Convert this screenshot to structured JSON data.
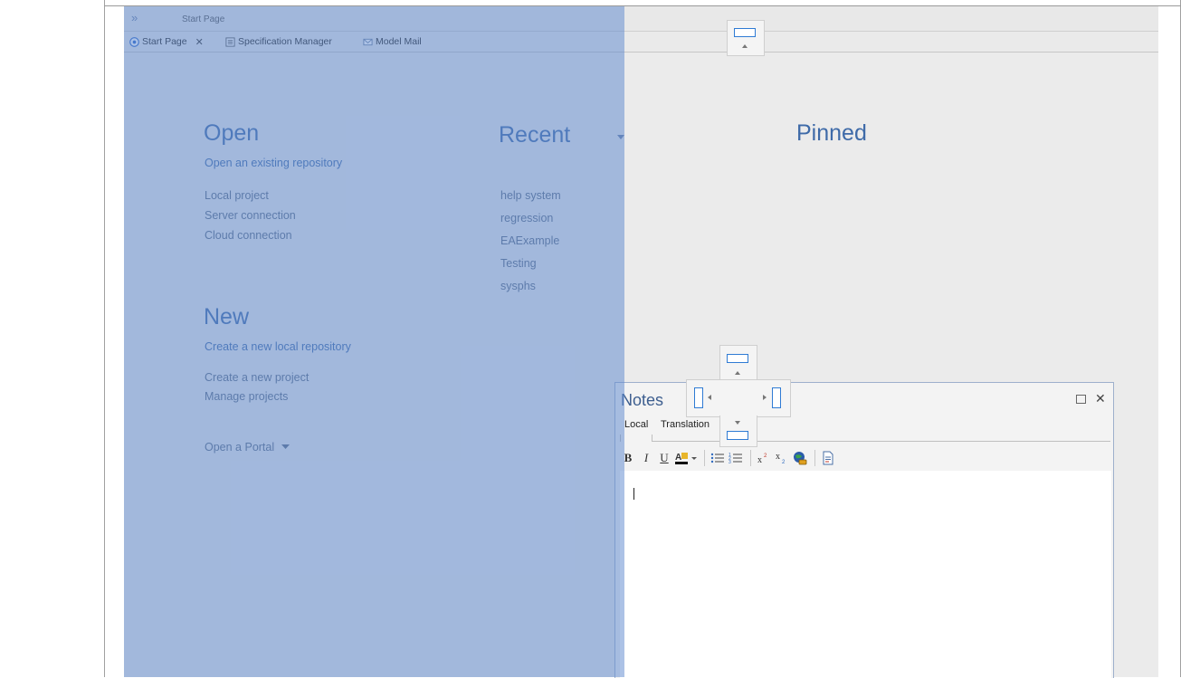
{
  "window": {
    "title": "Start Page"
  },
  "tabs": [
    {
      "label": "Start Page",
      "icon": "start-page-icon",
      "closable": true,
      "active": true
    },
    {
      "label": "Specification Manager",
      "icon": "specification-manager-icon"
    },
    {
      "label": "Model Mail",
      "icon": "mail-icon"
    }
  ],
  "start_page": {
    "open": {
      "heading": "Open",
      "subheading": "Open an existing repository",
      "links": [
        "Local project",
        "Server connection",
        "Cloud connection"
      ]
    },
    "new": {
      "heading": "New",
      "subheading": "Create a new local repository",
      "links": [
        "Create a new project",
        "Manage projects"
      ],
      "portal": "Open a Portal"
    },
    "recent": {
      "heading": "Recent",
      "items": [
        "help system",
        "regression",
        "EAExample",
        "Testing",
        "sysphs"
      ]
    },
    "pinned": {
      "heading": "Pinned"
    }
  },
  "notes": {
    "title": "Notes",
    "tabs": [
      "Local",
      "Translation"
    ],
    "toolbar": {
      "bold": "B",
      "italic": "I",
      "underline": "U"
    }
  },
  "colors": {
    "overlay": "#5f8ad0",
    "heading": "#3e6aa8",
    "link": "#5a6c85",
    "guide_accent": "#2f7bd4"
  }
}
